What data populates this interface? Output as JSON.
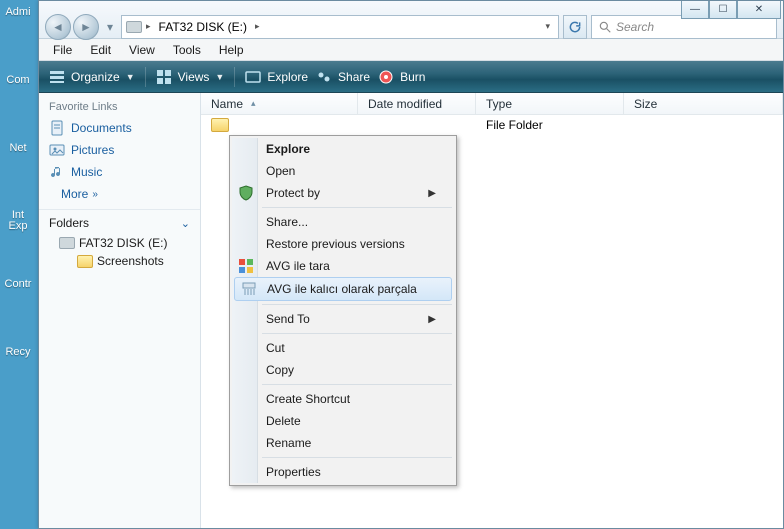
{
  "desktop": {
    "icons": [
      "Admi",
      "Com",
      "Net",
      "Int Exp",
      "Contr",
      "Recy"
    ]
  },
  "titlecontrols": {
    "min": "—",
    "max": "☐",
    "close": "✕"
  },
  "address": {
    "drive_label": "FAT32 DISK (E:)",
    "refresh_glyph": "↻",
    "search_placeholder": "Search"
  },
  "menubar": [
    "File",
    "Edit",
    "View",
    "Tools",
    "Help"
  ],
  "toolbar": {
    "organize": "Organize",
    "views": "Views",
    "explore": "Explore",
    "share": "Share",
    "burn": "Burn"
  },
  "sidebar": {
    "fav_title": "Favorite Links",
    "links": [
      {
        "label": "Documents"
      },
      {
        "label": "Pictures"
      },
      {
        "label": "Music"
      }
    ],
    "more": "More",
    "folders_title": "Folders",
    "tree": {
      "drive": "FAT32 DISK (E:)",
      "child": "Screenshots"
    }
  },
  "columns": {
    "name": "Name",
    "date": "Date modified",
    "type": "Type",
    "size": "Size"
  },
  "rows": [
    {
      "name": "",
      "date": "",
      "type": "File Folder",
      "size": ""
    }
  ],
  "context_menu": {
    "items": [
      {
        "label": "Explore",
        "bold": true
      },
      {
        "label": "Open"
      },
      {
        "label": "Protect by",
        "submenu": true,
        "icon": "shield"
      },
      {
        "sep": true
      },
      {
        "label": "Share..."
      },
      {
        "label": "Restore previous versions"
      },
      {
        "label": "AVG ile tara",
        "icon": "avg"
      },
      {
        "label": "AVG ile kalıcı olarak parçala",
        "icon": "shred",
        "hover": true
      },
      {
        "sep": true
      },
      {
        "label": "Send To",
        "submenu": true
      },
      {
        "sep": true
      },
      {
        "label": "Cut"
      },
      {
        "label": "Copy"
      },
      {
        "sep": true
      },
      {
        "label": "Create Shortcut"
      },
      {
        "label": "Delete"
      },
      {
        "label": "Rename"
      },
      {
        "sep": true
      },
      {
        "label": "Properties"
      }
    ]
  }
}
